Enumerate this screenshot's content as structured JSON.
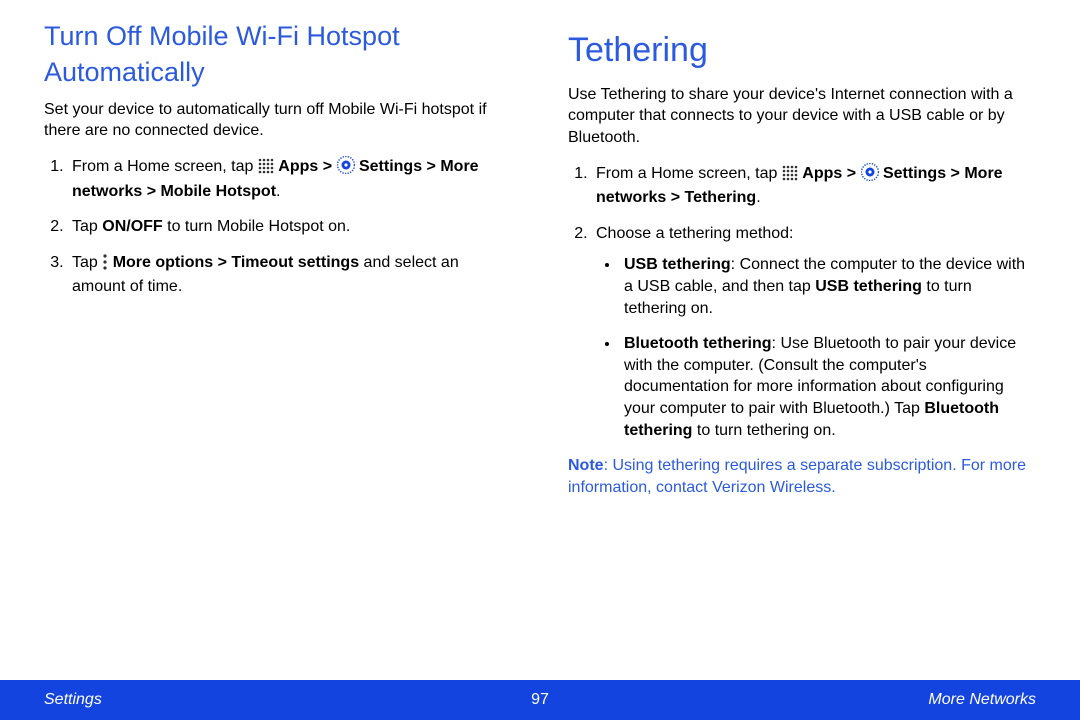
{
  "left": {
    "heading": "Turn Off Mobile Wi-Fi Hotspot Automatically",
    "intro": "Set your device to automatically turn off Mobile Wi-Fi hotspot if there are no connected device.",
    "step1_pre": "From a Home screen, tap ",
    "apps_label": "Apps",
    "gt": " > ",
    "settings_label": "Settings",
    "step1_post": "More networks > Mobile Hotspot",
    "step2_pre": "Tap ",
    "onoff": "ON/OFF",
    "step2_post": " to turn Mobile Hotspot on.",
    "step3_pre": "Tap ",
    "more_opts": "More options > Timeout settings",
    "step3_post": " and select an amount of time."
  },
  "right": {
    "heading": "Tethering",
    "intro": "Use Tethering to share your device's Internet connection with a computer that connects to your device with a USB cable or by Bluetooth.",
    "step1_pre": "From a Home screen, tap ",
    "apps_label": "Apps",
    "gt": " > ",
    "settings_label": "Settings",
    "step1_post": "More networks > Tethering",
    "step2": "Choose a tethering method:",
    "usb_b": "USB tethering",
    "usb_1": ": Connect the computer to the device with a USB cable, and then tap ",
    "usb_b2": "USB tethering",
    "usb_2": " to turn tethering on.",
    "bt_b": "Bluetooth tethering",
    "bt_1": ": Use Bluetooth to pair your device with the computer. (Consult the computer's documentation for more information about configuring your computer to pair with Bluetooth.) Tap ",
    "bt_b2": "Bluetooth tethering",
    "bt_2": " to turn tethering on.",
    "note_b": "Note",
    "note_1": ": Using tethering requires a separate subscription. For more information, contact Verizon Wireless."
  },
  "footer": {
    "left": "Settings",
    "center": "97",
    "right": "More Networks"
  }
}
